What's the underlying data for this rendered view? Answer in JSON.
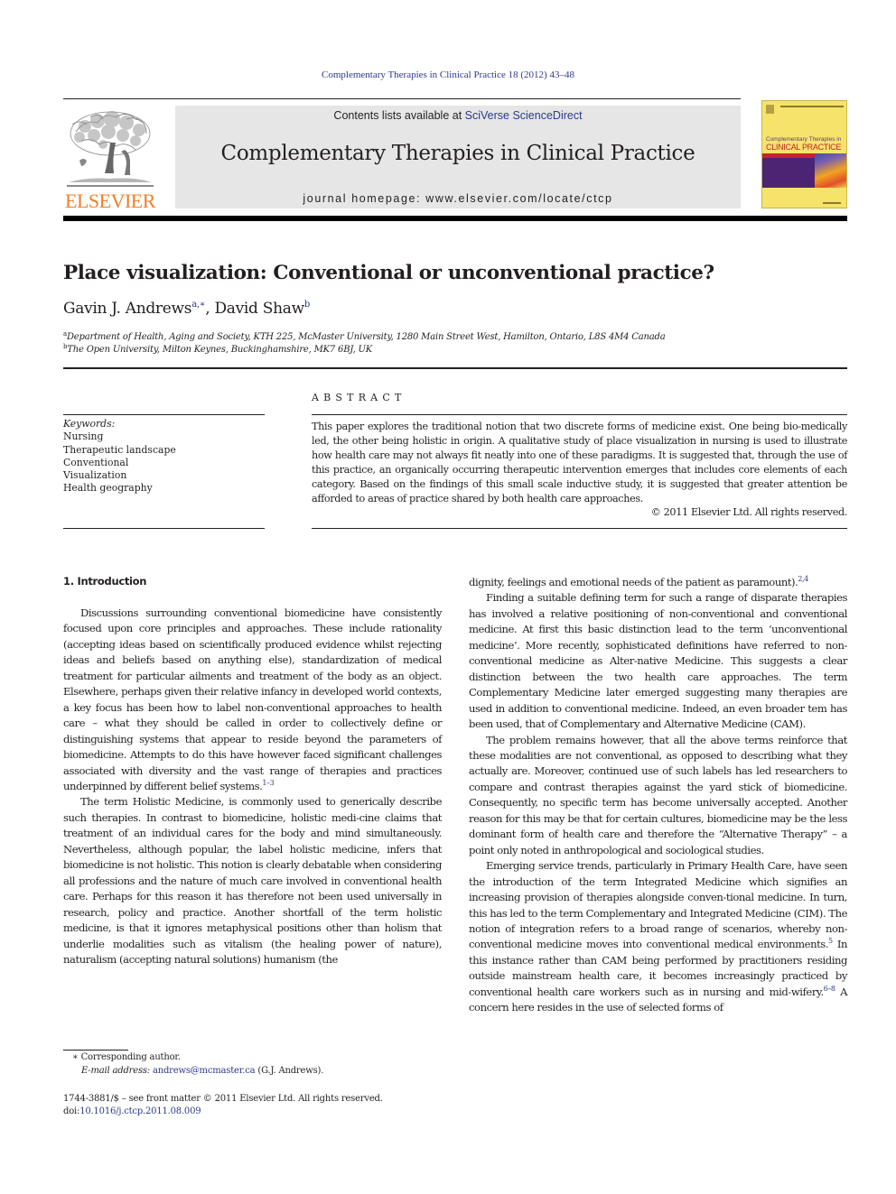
{
  "running_head": "Complementary Therapies in Clinical Practice 18 (2012) 43–48",
  "publisher": {
    "name": "ELSEVIER",
    "brand_color": "#f07e26"
  },
  "masthead": {
    "contents_prefix": "Contents lists available at ",
    "contents_link": "SciVerse ScienceDirect",
    "journal_title": "Complementary Therapies in Clinical Practice",
    "homepage_label": "journal homepage: ",
    "homepage_url": "www.elsevier.com/locate/ctcp"
  },
  "cover": {
    "title_line1": "Complementary Therapies in",
    "title_line2": "CLINICAL PRACTICE"
  },
  "article": {
    "title": "Place visualization: Conventional or unconventional practice?",
    "authors": [
      {
        "name": "Gavin J. Andrews",
        "sup": "a,∗"
      },
      {
        "name": "David Shaw",
        "sup": "b"
      }
    ],
    "author_separator": ", ",
    "affiliations": [
      {
        "mark": "a",
        "text": "Department of Health, Aging and Society, KTH 225, McMaster University, 1280 Main Street West, Hamilton, Ontario, L8S 4M4 Canada"
      },
      {
        "mark": "b",
        "text": "The Open University, Milton Keynes, Buckinghamshire, MK7 6BJ, UK"
      }
    ]
  },
  "keywords": {
    "label": "Keywords:",
    "items": [
      "Nursing",
      "Therapeutic landscape",
      "Conventional",
      "Visualization",
      "Health geography"
    ]
  },
  "abstract": {
    "heading": "ABSTRACT",
    "text": "This paper explores the traditional notion that two discrete forms of medicine exist. One being bio-medically led, the other being holistic in origin. A qualitative study of place visualization in nursing is used to illustrate how health care may not always fit neatly into one of these paradigms. It is suggested that, through the use of this practice, an organically occurring therapeutic intervention emerges that includes core elements of each category. Based on the findings of this small scale inductive study, it is suggested that greater attention be afforded to areas of practice shared by both health care approaches.",
    "copyright": "© 2011 Elsevier Ltd. All rights reserved."
  },
  "body": {
    "section_heading": "1.  Introduction",
    "left_column": [
      {
        "text": "Discussions surrounding conventional biomedicine have consistently focused upon core principles and approaches. These include rationality (accepting ideas based on scientifically produced evidence whilst rejecting ideas and beliefs based on anything else), standardization of medical treatment for particular ailments and treatment of the body as an object. Elsewhere, perhaps given their relative infancy in developed world contexts, a key focus has been how to label non-conventional approaches to health care – what they should be called in order to collectively define or distinguishing systems that appear to reside beyond the parameters of biomedicine. Attempts to do this have however faced significant challenges associated with diversity and the vast range of therapies and practices underpinned by different belief systems.",
        "ref": "1–3",
        "after": ""
      },
      {
        "text": "The term Holistic Medicine, is commonly used to generically describe such therapies. In contrast to biomedicine, holistic medi-cine claims that treatment of an individual cares for the body and mind simultaneously. Nevertheless, although popular, the label holistic medicine, infers that biomedicine is not holistic. This notion is clearly debatable when considering all professions and the nature of much care involved in conventional health care. Perhaps for this reason it has therefore not been used universally in research, policy and practice. Another shortfall of the term holistic medicine, is that it ignores metaphysical positions other than holism that underlie modalities such as vitalism (the healing power of nature), naturalism (accepting natural solutions) humanism (the",
        "ref": "",
        "after": ""
      }
    ],
    "right_column": [
      {
        "text": "dignity, feelings and emotional needs of the patient as paramount).",
        "ref": "2,4",
        "after": "",
        "continued": true
      },
      {
        "text": "Finding a suitable defining term for such a range of disparate therapies has involved a relative positioning of non-conventional and conventional medicine. At first this basic distinction lead to the term ‘unconventional medicine’. More recently, sophisticated definitions have referred to non-conventional medicine as Alter-native Medicine. This suggests a clear distinction between the two health care approaches. The term Complementary Medicine later emerged suggesting many therapies are used in addition to conventional medicine. Indeed, an even broader tem has been used, that of Complementary and Alternative Medicine (CAM).",
        "ref": "",
        "after": ""
      },
      {
        "text": "The problem remains however, that all the above terms reinforce that these modalities are not conventional, as opposed to describing what they actually are. Moreover, continued use of such labels has led researchers to compare and contrast therapies against the yard stick of biomedicine. Consequently, no specific term has become universally accepted. Another reason for this may be that for certain cultures, biomedicine may be the less dominant form of health care and therefore the “Alternative Therapy” – a point only noted in anthropological and sociological studies.",
        "ref": "",
        "after": ""
      },
      {
        "text": "Emerging service trends, particularly in Primary Health Care, have seen the introduction of the term Integrated Medicine which signifies an increasing provision of therapies alongside conven-tional medicine. In turn, this has led to the term Complementary and Integrated Medicine (CIM). The notion of integration refers to a broad range of scenarios, whereby non-conventional medicine moves into conventional medical environments.",
        "ref": "5",
        "after": " In this instance rather than CAM being performed by practitioners residing outside mainstream health care, it becomes increasingly practiced by conventional health care workers such as in nursing and mid-wifery.",
        "ref2": "6–8",
        "after2": " A concern here resides in the use of selected forms of"
      }
    ]
  },
  "footnotes": {
    "corresponding_mark": "∗",
    "corresponding_text": " Corresponding author.",
    "email_label": "E-mail address: ",
    "email": "andrews@mcmaster.ca",
    "email_suffix": " (G.J. Andrews).",
    "front_matter": "1744-3881/$ – see front matter © 2011 Elsevier Ltd. All rights reserved.",
    "doi_label": "doi:",
    "doi": "10.1016/j.ctcp.2011.08.009"
  },
  "colors": {
    "link": "#2b3a8c",
    "text": "#231f20",
    "masthead_bg": "#e6e6e6"
  }
}
